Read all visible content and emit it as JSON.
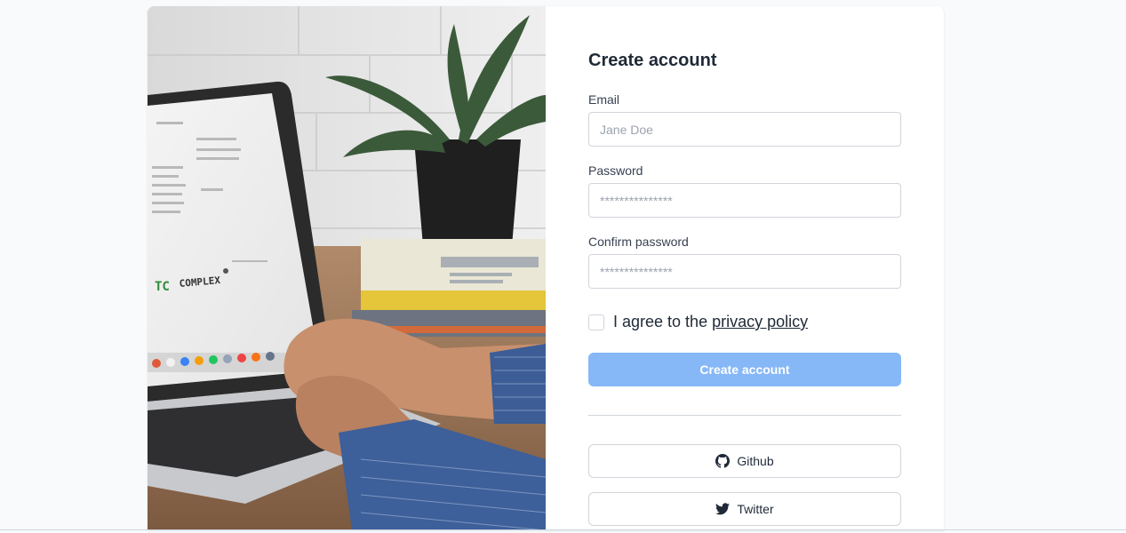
{
  "form": {
    "title": "Create account",
    "email": {
      "label": "Email",
      "placeholder": "Jane Doe"
    },
    "password": {
      "label": "Password",
      "placeholder": "***************"
    },
    "confirm_password": {
      "label": "Confirm password",
      "placeholder": "***************"
    },
    "agree": {
      "text": "I agree to the ",
      "link_text": "privacy policy",
      "checked": false
    },
    "submit_label": "Create account"
  },
  "social": [
    {
      "label": "Github",
      "icon": "github-icon"
    },
    {
      "label": "Twitter",
      "icon": "twitter-icon"
    }
  ],
  "hero": {
    "image": "laptop-photo",
    "screen_text": "TC COMPLEX"
  },
  "colors": {
    "primary_button": "#86b7f7",
    "background": "#f8fafc"
  }
}
